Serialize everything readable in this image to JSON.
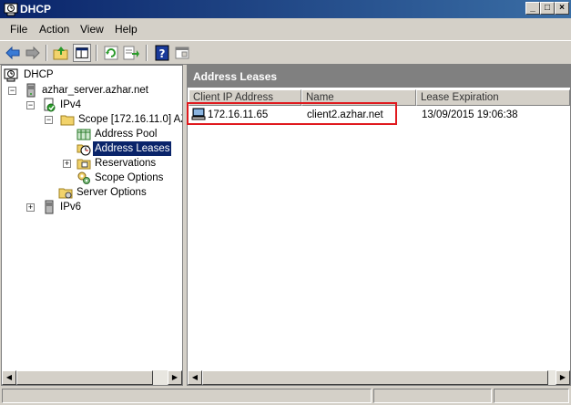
{
  "window": {
    "title": "DHCP",
    "minimize": "_",
    "maximize": "□",
    "close": "×"
  },
  "menu": [
    "File",
    "Action",
    "View",
    "Help"
  ],
  "toolbar": [
    "back-icon",
    "forward-icon",
    "up-folder-icon",
    "show-hide-tree-icon",
    "refresh-icon",
    "export-list-icon",
    "help-icon",
    "properties-icon"
  ],
  "tree": {
    "root": "DHCP",
    "server": "azhar_server.azhar.net",
    "ipv4": "IPv4",
    "scope": "Scope [172.16.11.0] AZ",
    "address_pool": "Address Pool",
    "address_leases": "Address Leases",
    "reservations": "Reservations",
    "scope_options": "Scope Options",
    "server_options": "Server Options",
    "ipv6": "IPv6"
  },
  "details": {
    "header": "Address Leases",
    "columns": [
      "Client IP Address",
      "Name",
      "Lease Expiration"
    ],
    "rows": [
      {
        "ip": "172.16.11.65",
        "name": "client2.azhar.net",
        "expiration": "13/09/2015 19:06:38"
      }
    ]
  },
  "colors": {
    "title_bar": "#0a246a",
    "selection": "#0a246a",
    "highlight_border": "#e0191e"
  }
}
